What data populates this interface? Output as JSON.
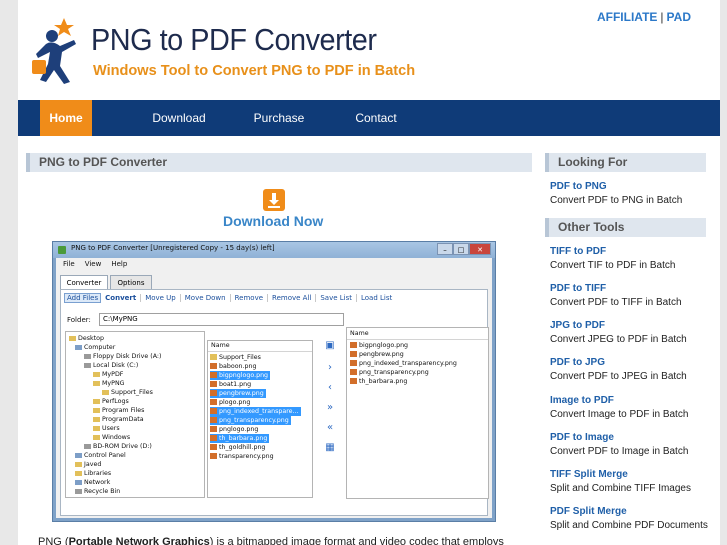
{
  "header": {
    "title": "PNG to PDF Converter",
    "subtitle": "Windows Tool to Convert PNG to PDF in Batch",
    "affiliate": "AFFILIATE",
    "separator": "|",
    "pad": "PAD"
  },
  "nav": [
    {
      "label": "Home",
      "active": true
    },
    {
      "label": "Download"
    },
    {
      "label": "Purchase"
    },
    {
      "label": "Contact"
    }
  ],
  "main": {
    "heading": "PNG to PDF Converter",
    "download_label": "Download Now",
    "para_start": "PNG (",
    "para_bold": "Portable Network Graphics",
    "para_rest": ") is a bitmapped image format and video codec that employs"
  },
  "app": {
    "window_title": "PNG to PDF Converter [Unregistered Copy - 15 day(s) left]",
    "menu": [
      "File",
      "View",
      "Help"
    ],
    "tabs": [
      "Converter",
      "Options"
    ],
    "toolbar": [
      "Add Files",
      "Convert",
      "Move Up",
      "Move Down",
      "Remove",
      "Remove All",
      "Save List",
      "Load List"
    ],
    "folder_label": "Folder:",
    "folder_value": "C:\\MyPNG",
    "tree": [
      "Desktop",
      "Computer",
      "Floppy Disk Drive (A:)",
      "Local Disk (C:)",
      "MyPDF",
      "MyPNG",
      "Support_Files",
      "PerfLogs",
      "Program Files",
      "ProgramData",
      "Users",
      "Windows",
      "BD-ROM Drive (D:)",
      "Control Panel",
      "Javed",
      "Libraries",
      "Network",
      "Recycle Bin"
    ],
    "list_header": "Name",
    "files": [
      {
        "name": "Support_Files",
        "sel": false
      },
      {
        "name": "baboon.png",
        "sel": false
      },
      {
        "name": "bigpnglogo.png",
        "sel": true
      },
      {
        "name": "boat1.png",
        "sel": false
      },
      {
        "name": "pengbrew.png",
        "sel": true
      },
      {
        "name": "plogo.png",
        "sel": false
      },
      {
        "name": "png_indexed_transpare...",
        "sel": true
      },
      {
        "name": "png_transparency.png",
        "sel": true
      },
      {
        "name": "pnglogo.png",
        "sel": false
      },
      {
        "name": "th_barbara.png",
        "sel": true
      },
      {
        "name": "th_goldhill.png",
        "sel": false
      },
      {
        "name": "transparency.png",
        "sel": false
      }
    ],
    "output_header": "Name",
    "output": [
      "bigpnglogo.png",
      "pengbrew.png",
      "png_indexed_transparency.png",
      "png_transparency.png",
      "th_barbara.png"
    ]
  },
  "sidebar": {
    "looking_for": "Looking For",
    "other_tools": "Other Tools",
    "items": [
      {
        "title": "PDF to PNG",
        "desc": "Convert PDF to PNG in Batch"
      },
      {
        "title": "TIFF to PDF",
        "desc": "Convert TIF to PDF in Batch"
      },
      {
        "title": "PDF to TIFF",
        "desc": "Convert PDF to TIFF in Batch"
      },
      {
        "title": "JPG to PDF",
        "desc": "Convert JPEG to PDF in Batch"
      },
      {
        "title": "PDF to JPG",
        "desc": "Convert PDF to JPEG in Batch"
      },
      {
        "title": "Image to PDF",
        "desc": "Convert Image to PDF in Batch"
      },
      {
        "title": "PDF to Image",
        "desc": "Convert PDF to Image in Batch"
      },
      {
        "title": "TIFF Split Merge",
        "desc": "Split and Combine TIFF Images"
      },
      {
        "title": "PDF Split Merge",
        "desc": "Split and Combine PDF Documents"
      }
    ]
  },
  "colors": {
    "nav_bg": "#0f3b78",
    "accent": "#f08c19",
    "link": "#1f5fa8"
  }
}
